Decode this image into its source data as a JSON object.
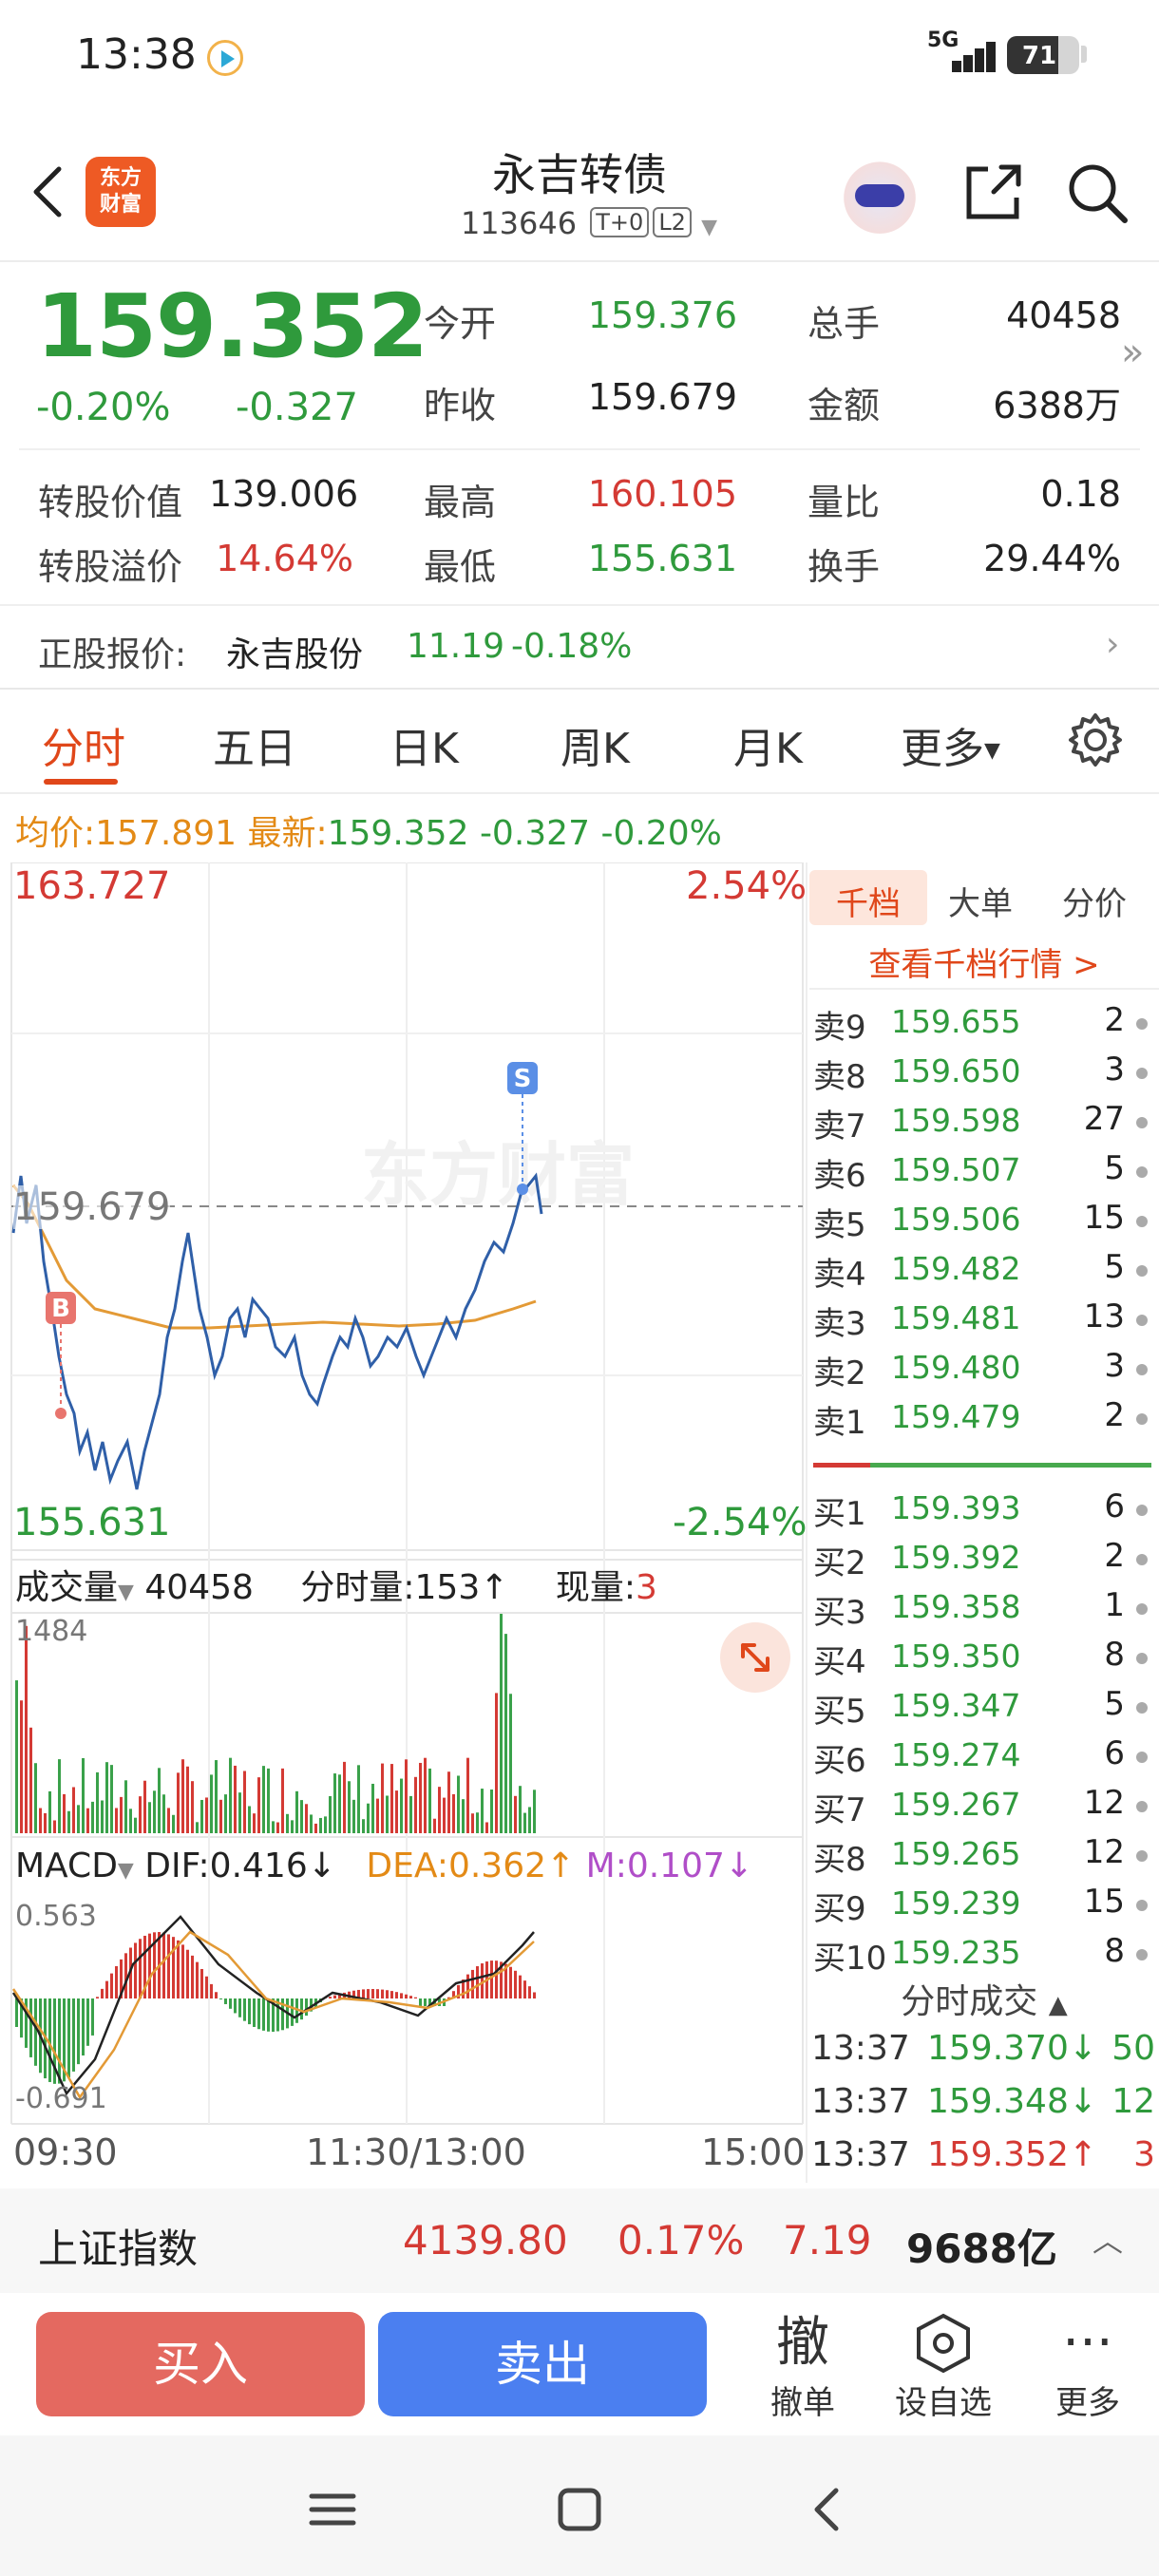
{
  "status_bar": {
    "time": "13:38",
    "network": "5G",
    "battery": "71",
    "battery_level": 0.71
  },
  "header": {
    "logo_text_1": "东方",
    "logo_text_2": "财富",
    "title": "永吉转债",
    "code": "113646",
    "tag_t0": "T+0",
    "tag_l2": "L2"
  },
  "quote": {
    "price": "159.352",
    "change_pct": "-0.20%",
    "change_abs": "-0.327",
    "open_label": "今开",
    "open": "159.376",
    "prev_label": "昨收",
    "prev": "159.679",
    "vol_label": "总手",
    "vol": "40458",
    "amt_label": "金额",
    "amt": "6388万",
    "conv_value_label": "转股价值",
    "conv_value": "139.006",
    "premium_label": "转股溢价",
    "premium": "14.64%",
    "high_label": "最高",
    "high": "160.105",
    "low_label": "最低",
    "low": "155.631",
    "vr_label": "量比",
    "vr": "0.18",
    "turnover_label": "换手",
    "turnover": "29.44%"
  },
  "underlying": {
    "label": "正股报价:",
    "name": "永吉股份",
    "price": "11.19",
    "change": "-0.18%"
  },
  "tabs": [
    "分时",
    "五日",
    "日K",
    "周K",
    "月K",
    "更多"
  ],
  "chart_info": {
    "avg_label": "均价:",
    "avg": "157.891",
    "latest_label": "最新:",
    "latest": "159.352",
    "chg": "-0.327",
    "pct": "-0.20%",
    "top_price": "163.727",
    "bottom_price": "155.631",
    "top_pct": "2.54%",
    "bottom_pct": "-2.54%",
    "prev_close": "159.679",
    "watermark": "东方财富",
    "marker_b": "B",
    "marker_s": "S"
  },
  "volume_panel": {
    "label": "成交量",
    "total": "40458",
    "fs_label": "分时量:153↑",
    "now_label": "现量:",
    "now": "3",
    "max": "1484"
  },
  "macd_panel": {
    "label": "MACD",
    "dif": "DIF:0.416↓",
    "dea": "DEA:0.362↑",
    "m": "M:0.107↓",
    "max": "0.563",
    "min": "-0.691"
  },
  "time_axis": [
    "09:30",
    "11:30/13:00",
    "15:00"
  ],
  "order_book": {
    "tabs": [
      "千档",
      "大单",
      "分价"
    ],
    "link": "查看千档行情 >",
    "sells": [
      {
        "label": "卖9",
        "price": "159.655",
        "qty": "2"
      },
      {
        "label": "卖8",
        "price": "159.650",
        "qty": "3"
      },
      {
        "label": "卖7",
        "price": "159.598",
        "qty": "27"
      },
      {
        "label": "卖6",
        "price": "159.507",
        "qty": "5"
      },
      {
        "label": "卖5",
        "price": "159.506",
        "qty": "15"
      },
      {
        "label": "卖4",
        "price": "159.482",
        "qty": "5"
      },
      {
        "label": "卖3",
        "price": "159.481",
        "qty": "13"
      },
      {
        "label": "卖2",
        "price": "159.480",
        "qty": "3"
      },
      {
        "label": "卖1",
        "price": "159.479",
        "qty": "2"
      }
    ],
    "buys": [
      {
        "label": "买1",
        "price": "159.393",
        "qty": "6"
      },
      {
        "label": "买2",
        "price": "159.392",
        "qty": "2"
      },
      {
        "label": "买3",
        "price": "159.358",
        "qty": "1"
      },
      {
        "label": "买4",
        "price": "159.350",
        "qty": "8"
      },
      {
        "label": "买5",
        "price": "159.347",
        "qty": "5"
      },
      {
        "label": "买6",
        "price": "159.274",
        "qty": "6"
      },
      {
        "label": "买7",
        "price": "159.267",
        "qty": "12"
      },
      {
        "label": "买8",
        "price": "159.265",
        "qty": "12"
      },
      {
        "label": "买9",
        "price": "159.239",
        "qty": "15"
      },
      {
        "label": "买10",
        "price": "159.235",
        "qty": "8"
      }
    ],
    "tick_title": "分时成交",
    "ticks": [
      {
        "time": "13:37",
        "price": "159.370↓",
        "vol": "50",
        "color": "#2f9a3c"
      },
      {
        "time": "13:37",
        "price": "159.348↓",
        "vol": "12",
        "color": "#2f9a3c"
      },
      {
        "time": "13:37",
        "price": "159.352↑",
        "vol": "3",
        "color": "#d43a34"
      }
    ]
  },
  "index_bar": {
    "name": "上证指数",
    "value": "4139.80",
    "pct": "0.17%",
    "chg": "7.19",
    "amount": "9688亿"
  },
  "actions": {
    "buy": "买入",
    "sell": "卖出",
    "cancel_icon": "撤",
    "cancel": "撤单",
    "watch": "设自选",
    "more": "更多"
  }
}
